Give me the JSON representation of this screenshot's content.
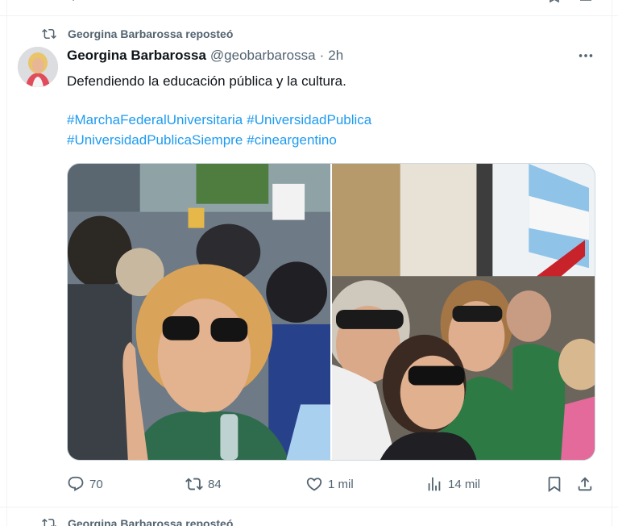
{
  "repost_label": "Georgina Barbarossa reposteó",
  "post": {
    "author_name": "Georgina Barbarossa",
    "handle": "@geobarbarossa",
    "separator": "·",
    "time": "2h",
    "text": "Defendiendo la educación pública y la cultura.",
    "hashtags": [
      "#MarchaFederalUniversitaria",
      "#UniversidadPublica",
      "#UniversidadPublicaSiempre",
      "#cineargentino"
    ]
  },
  "actions": {
    "replies": "70",
    "reposts": "84",
    "likes": "1 mil",
    "views": "14 mil"
  },
  "next_repost_label": "Georgina Barbarossa reposteó",
  "icons": {
    "repost": "repost-icon",
    "more": "more-icon",
    "reply": "reply-icon",
    "like": "heart-icon",
    "views": "views-icon",
    "bookmark": "bookmark-icon",
    "share": "share-icon"
  },
  "colors": {
    "text": "#0f1419",
    "secondary": "#536471",
    "link": "#1d9bf0",
    "border": "#eff3f4"
  }
}
